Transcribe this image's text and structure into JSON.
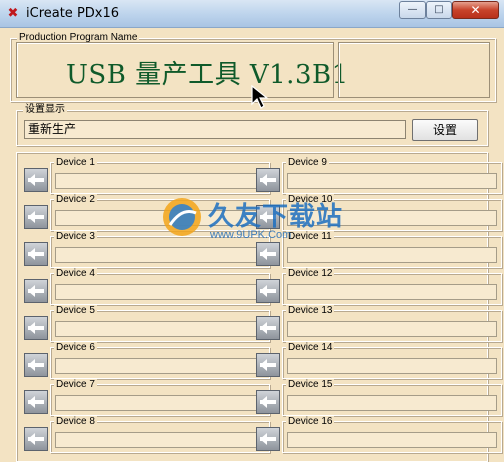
{
  "window": {
    "title": "iCreate PDx16",
    "min_glyph": "—",
    "max_glyph": "□",
    "close_glyph": "✕"
  },
  "production_group": {
    "label": "Production Program Name",
    "program_title": "USB 量产工具 V1.3B1"
  },
  "settings_group": {
    "label": "设置显示",
    "value": "重新生产",
    "button_label": "设置"
  },
  "devices": [
    {
      "label": "Device 1"
    },
    {
      "label": "Device 2"
    },
    {
      "label": "Device 3"
    },
    {
      "label": "Device 4"
    },
    {
      "label": "Device 5"
    },
    {
      "label": "Device 6"
    },
    {
      "label": "Device 7"
    },
    {
      "label": "Device 8"
    },
    {
      "label": "Device 9"
    },
    {
      "label": "Device 10"
    },
    {
      "label": "Device 11"
    },
    {
      "label": "Device 12"
    },
    {
      "label": "Device 13"
    },
    {
      "label": "Device 14"
    },
    {
      "label": "Device 15"
    },
    {
      "label": "Device 16"
    }
  ],
  "watermark": {
    "text": "久友下载站",
    "url": "www.9UPK.Com"
  },
  "colors": {
    "background": "#f3e3c3",
    "program_title": "#0f5a2a",
    "watermark": "#1d6fc0"
  }
}
